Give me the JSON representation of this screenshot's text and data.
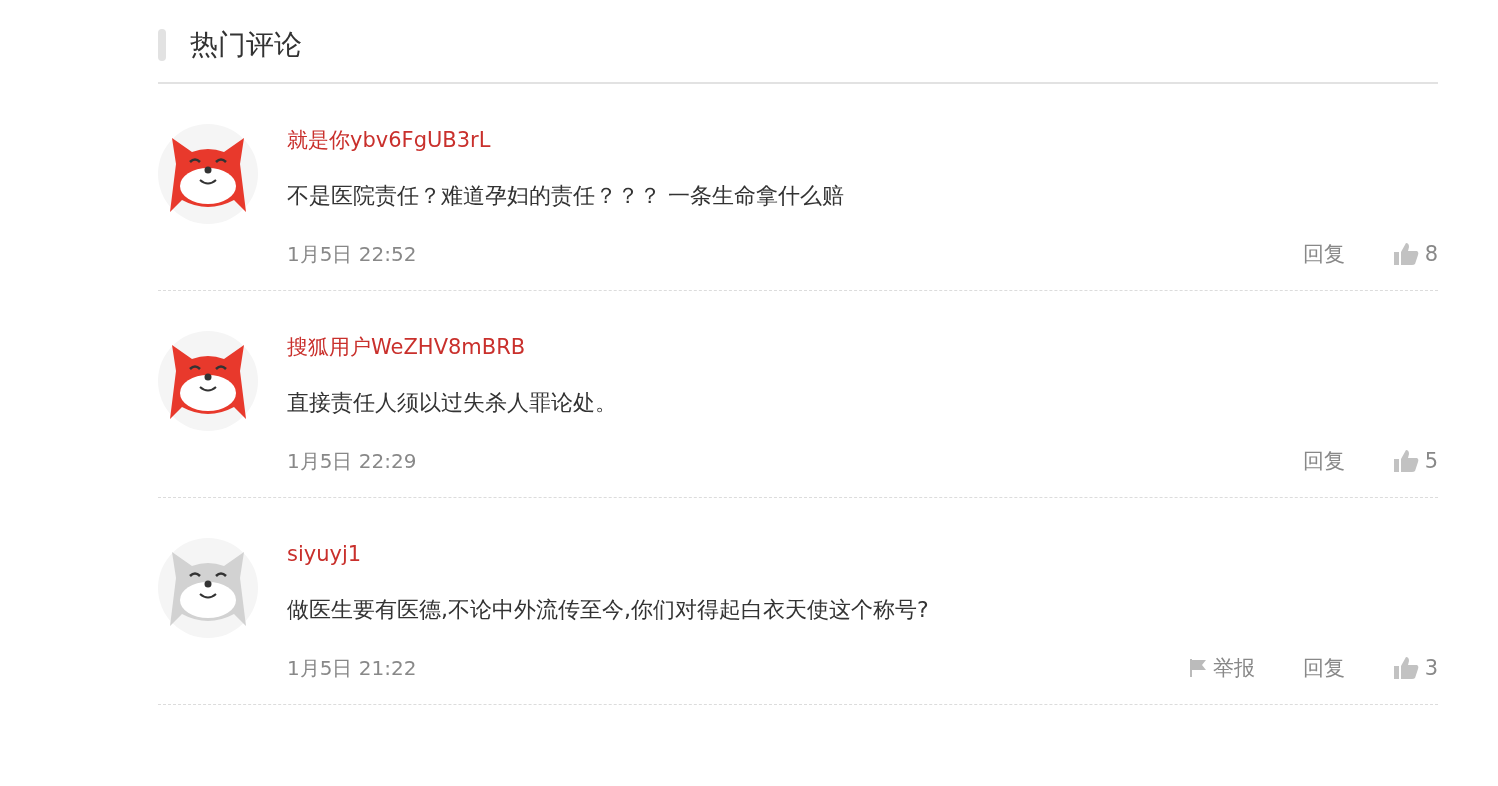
{
  "section": {
    "title": "热门评论"
  },
  "comments": [
    {
      "avatar": {
        "color": "#e8392c"
      },
      "user": "就是你ybv6FgUB3rL",
      "text": "不是医院责任？难道孕妇的责任？？？ 一条生命拿什么赔",
      "time": "1月5日 22:52",
      "reply": "回复",
      "likes": "8"
    },
    {
      "avatar": {
        "color": "#e8392c"
      },
      "user": "搜狐用户WeZHV8mBRB",
      "text": "直接责任人须以过失杀人罪论处。",
      "time": "1月5日 22:29",
      "reply": "回复",
      "likes": "5"
    },
    {
      "avatar": {
        "color": "#d2d2d2"
      },
      "user": "siyuyj1",
      "text": "做医生要有医德,不论中外流传至今,你们对得起白衣天使这个称号?",
      "time": "1月5日 21:22",
      "report": "举报",
      "reply": "回复",
      "likes": "3"
    }
  ]
}
